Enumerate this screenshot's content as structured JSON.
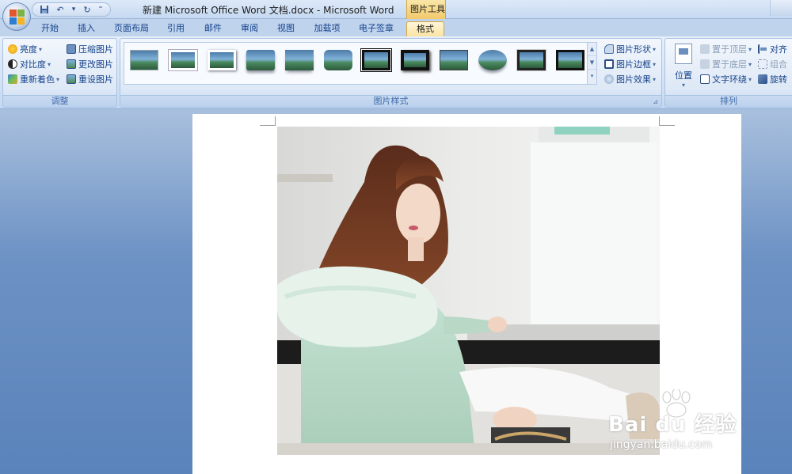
{
  "window": {
    "title": "新建 Microsoft Office Word 文档.docx - Microsoft Word",
    "context_tools": "图片工具"
  },
  "tabs": [
    "开始",
    "插入",
    "页面布局",
    "引用",
    "邮件",
    "审阅",
    "视图",
    "加载项",
    "电子签章",
    "格式"
  ],
  "active_tab": "格式",
  "ribbon": {
    "adjust": {
      "label": "调整",
      "brightness": "亮度",
      "contrast": "对比度",
      "recolor": "重新着色",
      "compress": "压缩图片",
      "change_picture": "更改图片",
      "reset_picture": "重设图片"
    },
    "styles": {
      "label": "图片样式",
      "shape": "图片形状",
      "border": "图片边框",
      "effects": "图片效果"
    },
    "arrange": {
      "label": "排列",
      "position": "位置",
      "bring_front": "置于顶层",
      "send_back": "置于底层",
      "text_wrap": "文字环绕",
      "align": "对齐",
      "group": "组合",
      "rotate": "旋转"
    }
  },
  "watermark": {
    "brand": "Bai du 经验",
    "url": "jingyan.baidu.com"
  },
  "colors": {
    "ribbon_bg": "#d6e3f4",
    "active_tab": "#fbe3a3",
    "doc_bg": "#6d92c4"
  }
}
